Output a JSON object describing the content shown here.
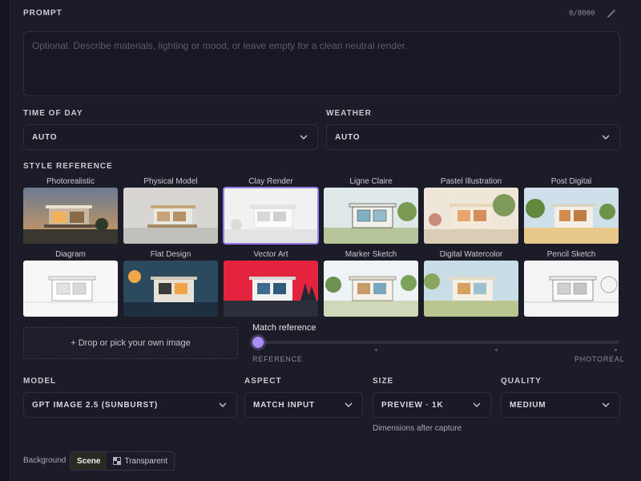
{
  "prompt": {
    "label": "PROMPT",
    "counter": "0/8000",
    "placeholder": "Optional. Describe materials, lighting or mood, or leave empty for a clean neutral render."
  },
  "time_of_day": {
    "label": "TIME OF DAY",
    "value": "AUTO"
  },
  "weather": {
    "label": "WEATHER",
    "value": "AUTO"
  },
  "style_reference": {
    "label": "STYLE REFERENCE",
    "selected": "Clay Render",
    "styles": [
      "Photorealistic",
      "Physical Model",
      "Clay Render",
      "Ligne Claire",
      "Pastel Illustration",
      "Post Digital",
      "Diagram",
      "Flat Design",
      "Vector Art",
      "Marker Sketch",
      "Digital Watercolor",
      "Pencil Sketch"
    ]
  },
  "dropzone": {
    "label": "+ Drop or pick your own image"
  },
  "match_reference": {
    "label": "Match reference",
    "left_label": "REFERENCE",
    "right_label": "PHOTOREAL",
    "value": 0
  },
  "model": {
    "label": "MODEL",
    "value": "GPT IMAGE 2.5 (SUNBURST)"
  },
  "aspect": {
    "label": "ASPECT",
    "value": "MATCH INPUT"
  },
  "size": {
    "label": "SIZE",
    "value": "PREVIEW · 1K",
    "hint": "Dimensions after capture"
  },
  "quality": {
    "label": "QUALITY",
    "value": "MEDIUM"
  },
  "background": {
    "label": "Background",
    "options": [
      "Scene",
      "Transparent"
    ],
    "selected": "Scene"
  },
  "colors": {
    "accent": "#a98cf6",
    "panel": "#1c1c28",
    "page": "#141420"
  }
}
